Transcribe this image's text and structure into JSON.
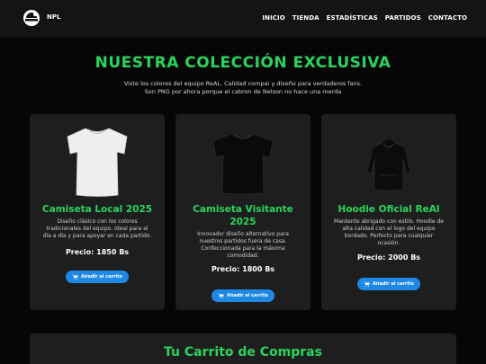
{
  "nav": {
    "brand": "NPL",
    "links": [
      "INICIO",
      "TIENDA",
      "ESTADÍSTICAS",
      "PARTIDOS",
      "CONTACTO"
    ]
  },
  "hero": {
    "title": "NUESTRA COLECCIÓN EXCLUSIVA",
    "subtitle_line1": "Viste los colores del equipo ReAL. Calidad compai y diseño para verdaderos fans.",
    "subtitle_line2": "Son PNG por ahora porque el cabron de Nelson no hace una merda"
  },
  "products": [
    {
      "image_icon": "white-tshirt-icon",
      "title": "Camiseta Local 2025",
      "description": "Diseño clásico con los colores tradicionales del equipo. Ideal para el día a día y para apoyar en cada partido.",
      "price": "Precio: 1850 Bs",
      "button_label": "Añadir al carrito"
    },
    {
      "image_icon": "black-tshirt-icon",
      "title": "Camiseta Visitante 2025",
      "description": "Innovador diseño alternativo para nuestros partidos fuera de casa. Confeccionada para la máxima comodidad.",
      "price": "Precio: 1800 Bs",
      "button_label": "Añadir al carrito"
    },
    {
      "image_icon": "hoodie-icon",
      "title": "Hoodie Oficial ReAl",
      "description": "Mantente abrigado con estilo. Hoodie de alta calidad con el logo del equipo bordado. Perfecto para cualquier ocasión.",
      "price": "Precio: 2000 Bs",
      "button_label": "Añadir al carrito"
    }
  ],
  "cart": {
    "title": "Tu Carrito de Compras"
  },
  "colors": {
    "accent_green": "#2ad45c",
    "button_blue": "#1e88e5",
    "card_bg": "#1e1e1e",
    "navbar_bg": "#141414"
  }
}
